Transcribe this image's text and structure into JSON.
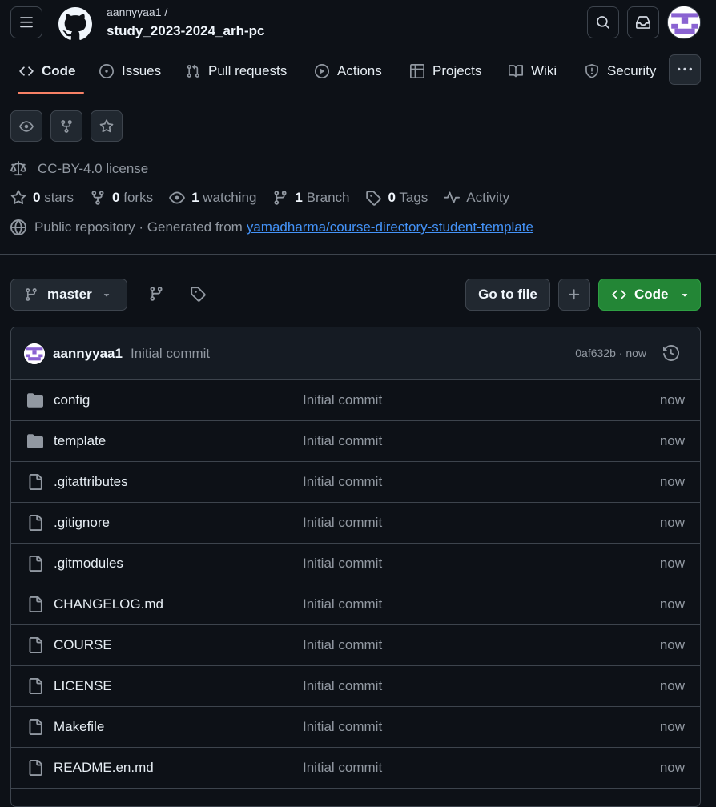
{
  "header": {
    "owner": "aannyyaa1 /",
    "repo": "study_2023-2024_arh-pc"
  },
  "tabs": [
    {
      "label": "Code",
      "icon": "code-icon",
      "active": true
    },
    {
      "label": "Issues",
      "icon": "issue-icon"
    },
    {
      "label": "Pull requests",
      "icon": "pull-request-icon"
    },
    {
      "label": "Actions",
      "icon": "play-icon"
    },
    {
      "label": "Projects",
      "icon": "table-icon"
    },
    {
      "label": "Wiki",
      "icon": "book-icon"
    },
    {
      "label": "Security",
      "icon": "shield-icon"
    }
  ],
  "meta": {
    "license": "CC-BY-4.0 license",
    "stars_count": "0",
    "stars_label": "stars",
    "forks_count": "0",
    "forks_label": "forks",
    "watching_count": "1",
    "watching_label": "watching",
    "branch_count": "1",
    "branch_label": "Branch",
    "tags_count": "0",
    "tags_label": "Tags",
    "activity_label": "Activity",
    "visibility_text": "Public repository · Generated from",
    "template_link": "yamadharma/course-directory-student-template"
  },
  "toolbar": {
    "branch": "master",
    "go_to_file": "Go to file",
    "code_button": "Code"
  },
  "latest_commit": {
    "user": "aannyyaa1",
    "message": "Initial commit",
    "hash_time": "0af632b · now"
  },
  "files": [
    {
      "type": "folder",
      "name": "config",
      "message": "Initial commit",
      "time": "now"
    },
    {
      "type": "folder",
      "name": "template",
      "message": "Initial commit",
      "time": "now"
    },
    {
      "type": "file",
      "name": ".gitattributes",
      "message": "Initial commit",
      "time": "now"
    },
    {
      "type": "file",
      "name": ".gitignore",
      "message": "Initial commit",
      "time": "now"
    },
    {
      "type": "file",
      "name": ".gitmodules",
      "message": "Initial commit",
      "time": "now"
    },
    {
      "type": "file",
      "name": "CHANGELOG.md",
      "message": "Initial commit",
      "time": "now"
    },
    {
      "type": "file",
      "name": "COURSE",
      "message": "Initial commit",
      "time": "now"
    },
    {
      "type": "file",
      "name": "LICENSE",
      "message": "Initial commit",
      "time": "now"
    },
    {
      "type": "file",
      "name": "Makefile",
      "message": "Initial commit",
      "time": "now"
    },
    {
      "type": "file",
      "name": "README.en.md",
      "message": "Initial commit",
      "time": "now"
    }
  ],
  "colors": {
    "background": "#0d1117",
    "border": "#3d444d",
    "muted": "#9198a1",
    "link": "#4493f8",
    "active_tab": "#f78166",
    "primary_button": "#238636",
    "avatar_accent": "#8a63d2"
  }
}
